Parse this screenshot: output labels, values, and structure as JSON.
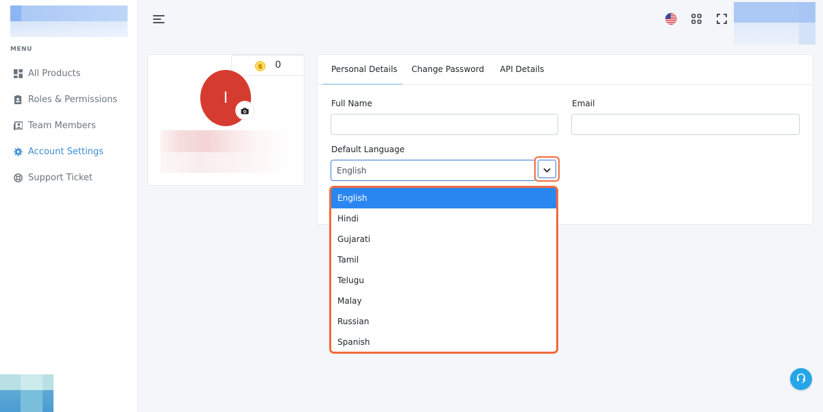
{
  "sidebar": {
    "menu_caption": "MENU",
    "items": [
      {
        "label": "All Products",
        "icon": "grid-icon"
      },
      {
        "label": "Roles & Permissions",
        "icon": "clipboard-icon"
      },
      {
        "label": "Team Members",
        "icon": "team-icon"
      },
      {
        "label": "Account Settings",
        "icon": "gear-icon",
        "active": true
      },
      {
        "label": "Support Ticket",
        "icon": "lifebuoy-icon"
      }
    ]
  },
  "topbar": {
    "menu_icon": "hamburger-icon",
    "language_icon": "us-flag-icon",
    "apps_icon": "apps-grid-icon",
    "fullscreen_icon": "fullscreen-icon"
  },
  "profile": {
    "credits": "0",
    "avatar_initial": "I"
  },
  "tabs": [
    "Personal Details",
    "Change Password",
    "API Details"
  ],
  "form": {
    "full_name_label": "Full Name",
    "full_name_value": "",
    "email_label": "Email",
    "email_value": "",
    "language_label": "Default Language",
    "language_value": "English"
  },
  "language_options": [
    "English",
    "Hindi",
    "Gujarati",
    "Tamil",
    "Telugu",
    "Malay",
    "Russian",
    "Spanish"
  ],
  "colors": {
    "accent": "#3d8ed6",
    "highlight": "#f06a3b",
    "selected_option": "#2a86f1",
    "avatar": "#d63b30",
    "help_button": "#25a6e6"
  }
}
